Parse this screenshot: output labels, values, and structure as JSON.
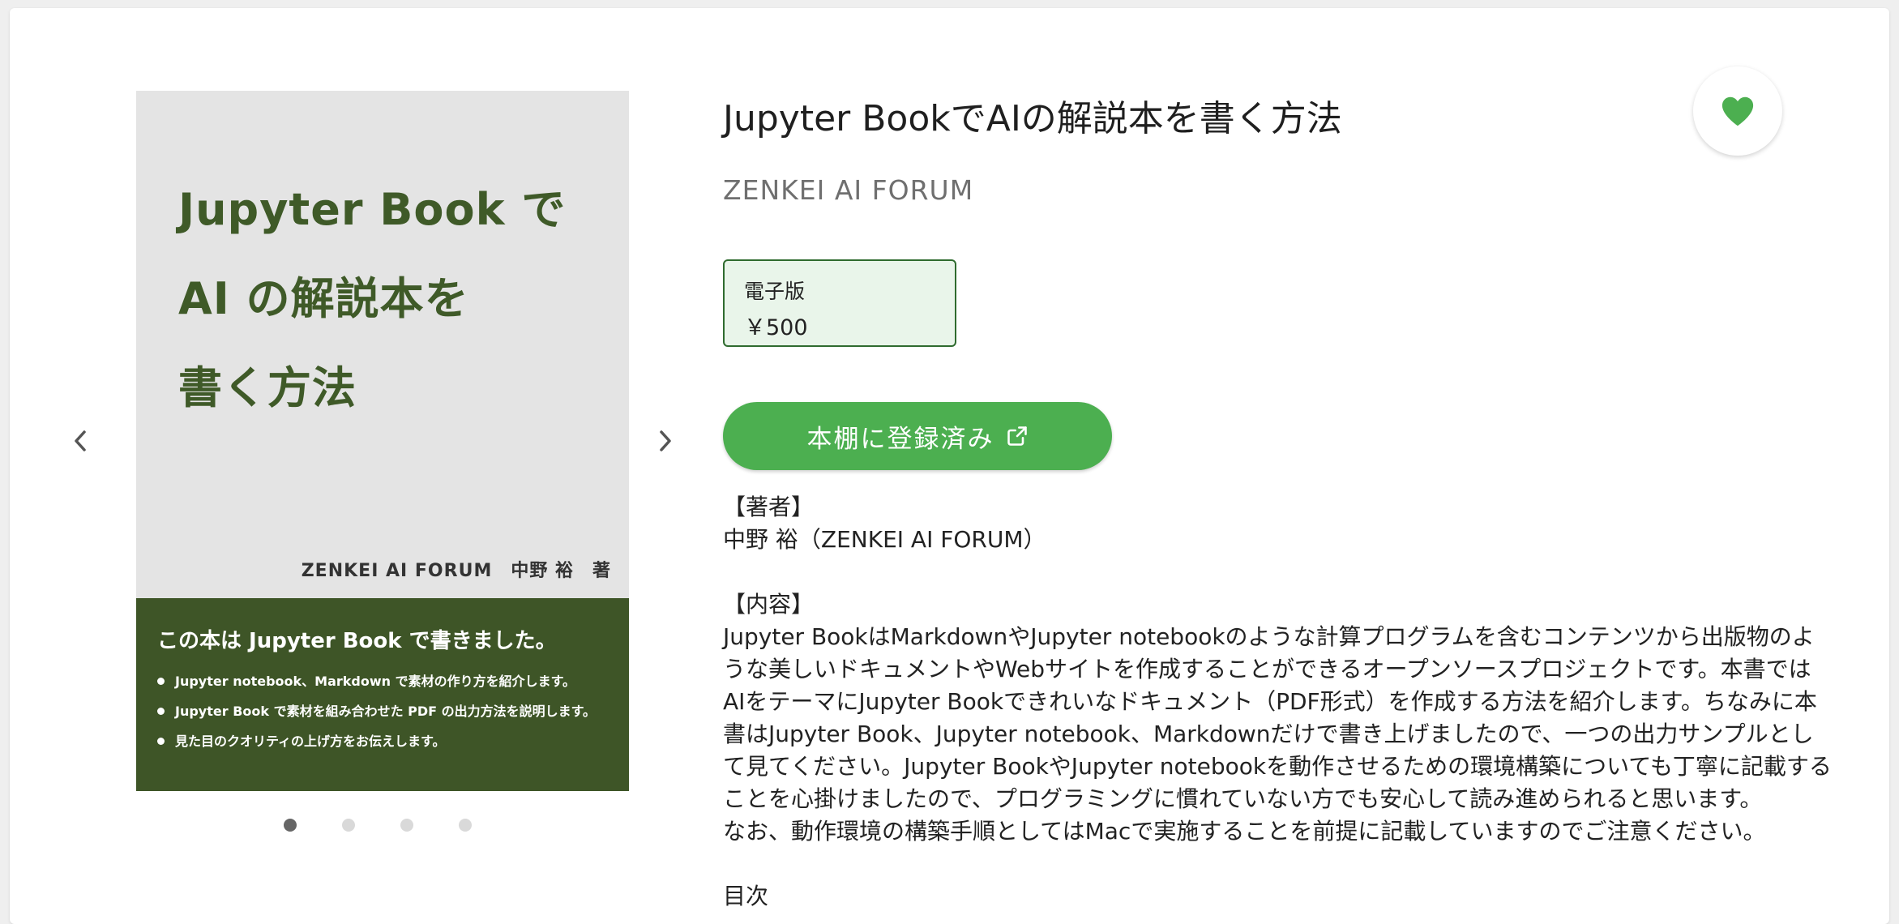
{
  "book": {
    "title": "Jupyter BookでAIの解説本を書く方法",
    "publisher": "ZENKEI AI FORUM"
  },
  "cover": {
    "title_lines": "Jupyter Book で\nAI の解説本を\n書く方法",
    "author_line": "ZENKEI AI FORUM　中野 裕　著",
    "band_heading": "この本は Jupyter Book で書きました。",
    "bullets": [
      "Jupyter notebook、Markdown で素材の作り方を紹介します。",
      "Jupyter Book で素材を組み合わせた PDF の出力方法を説明します。",
      "見た目のクオリティの上げ方をお伝えします。"
    ]
  },
  "gallery": {
    "page_count": 4,
    "active_index": 0
  },
  "price": {
    "label": "電子版",
    "value": "￥500"
  },
  "shelf_button": {
    "label": "本棚に登録済み"
  },
  "description": {
    "author_heading": "【著者】",
    "author": "中野 裕（ZENKEI AI FORUM）",
    "content_heading": "【内容】",
    "content_1": "Jupyter BookはMarkdownやJupyter notebookのような計算プログラムを含むコンテンツから出版物のような美しいドキュメントやWebサイトを作成することができるオープンソースプロジェクトです。本書ではAIをテーマにJupyter Bookできれいなドキュメント（PDF形式）を作成する方法を紹介します。ちなみに本書はJupyter Book、Jupyter notebook、Markdownだけで書き上げましたので、一つの出力サンプルとして見てください。Jupyter BookやJupyter notebookを動作させるための環境構築についても丁寧に記載することを心掛けましたので、プログラミングに慣れていない方でも安心して読み進められると思います。",
    "content_2": "なお、動作環境の構築手順としてはMacで実施することを前提に記載していますのでご注意ください。",
    "toc_heading": "目次"
  },
  "colors": {
    "accent": "#4caf50",
    "cover_green": "#3e5527",
    "cover_title": "#3f5a28",
    "price_bg": "#e9f5ea",
    "price_border": "#2f6b2f"
  },
  "icons": {
    "prev": "chevron-left-icon",
    "next": "chevron-right-icon",
    "favorite": "heart-icon",
    "external": "external-link-icon"
  }
}
